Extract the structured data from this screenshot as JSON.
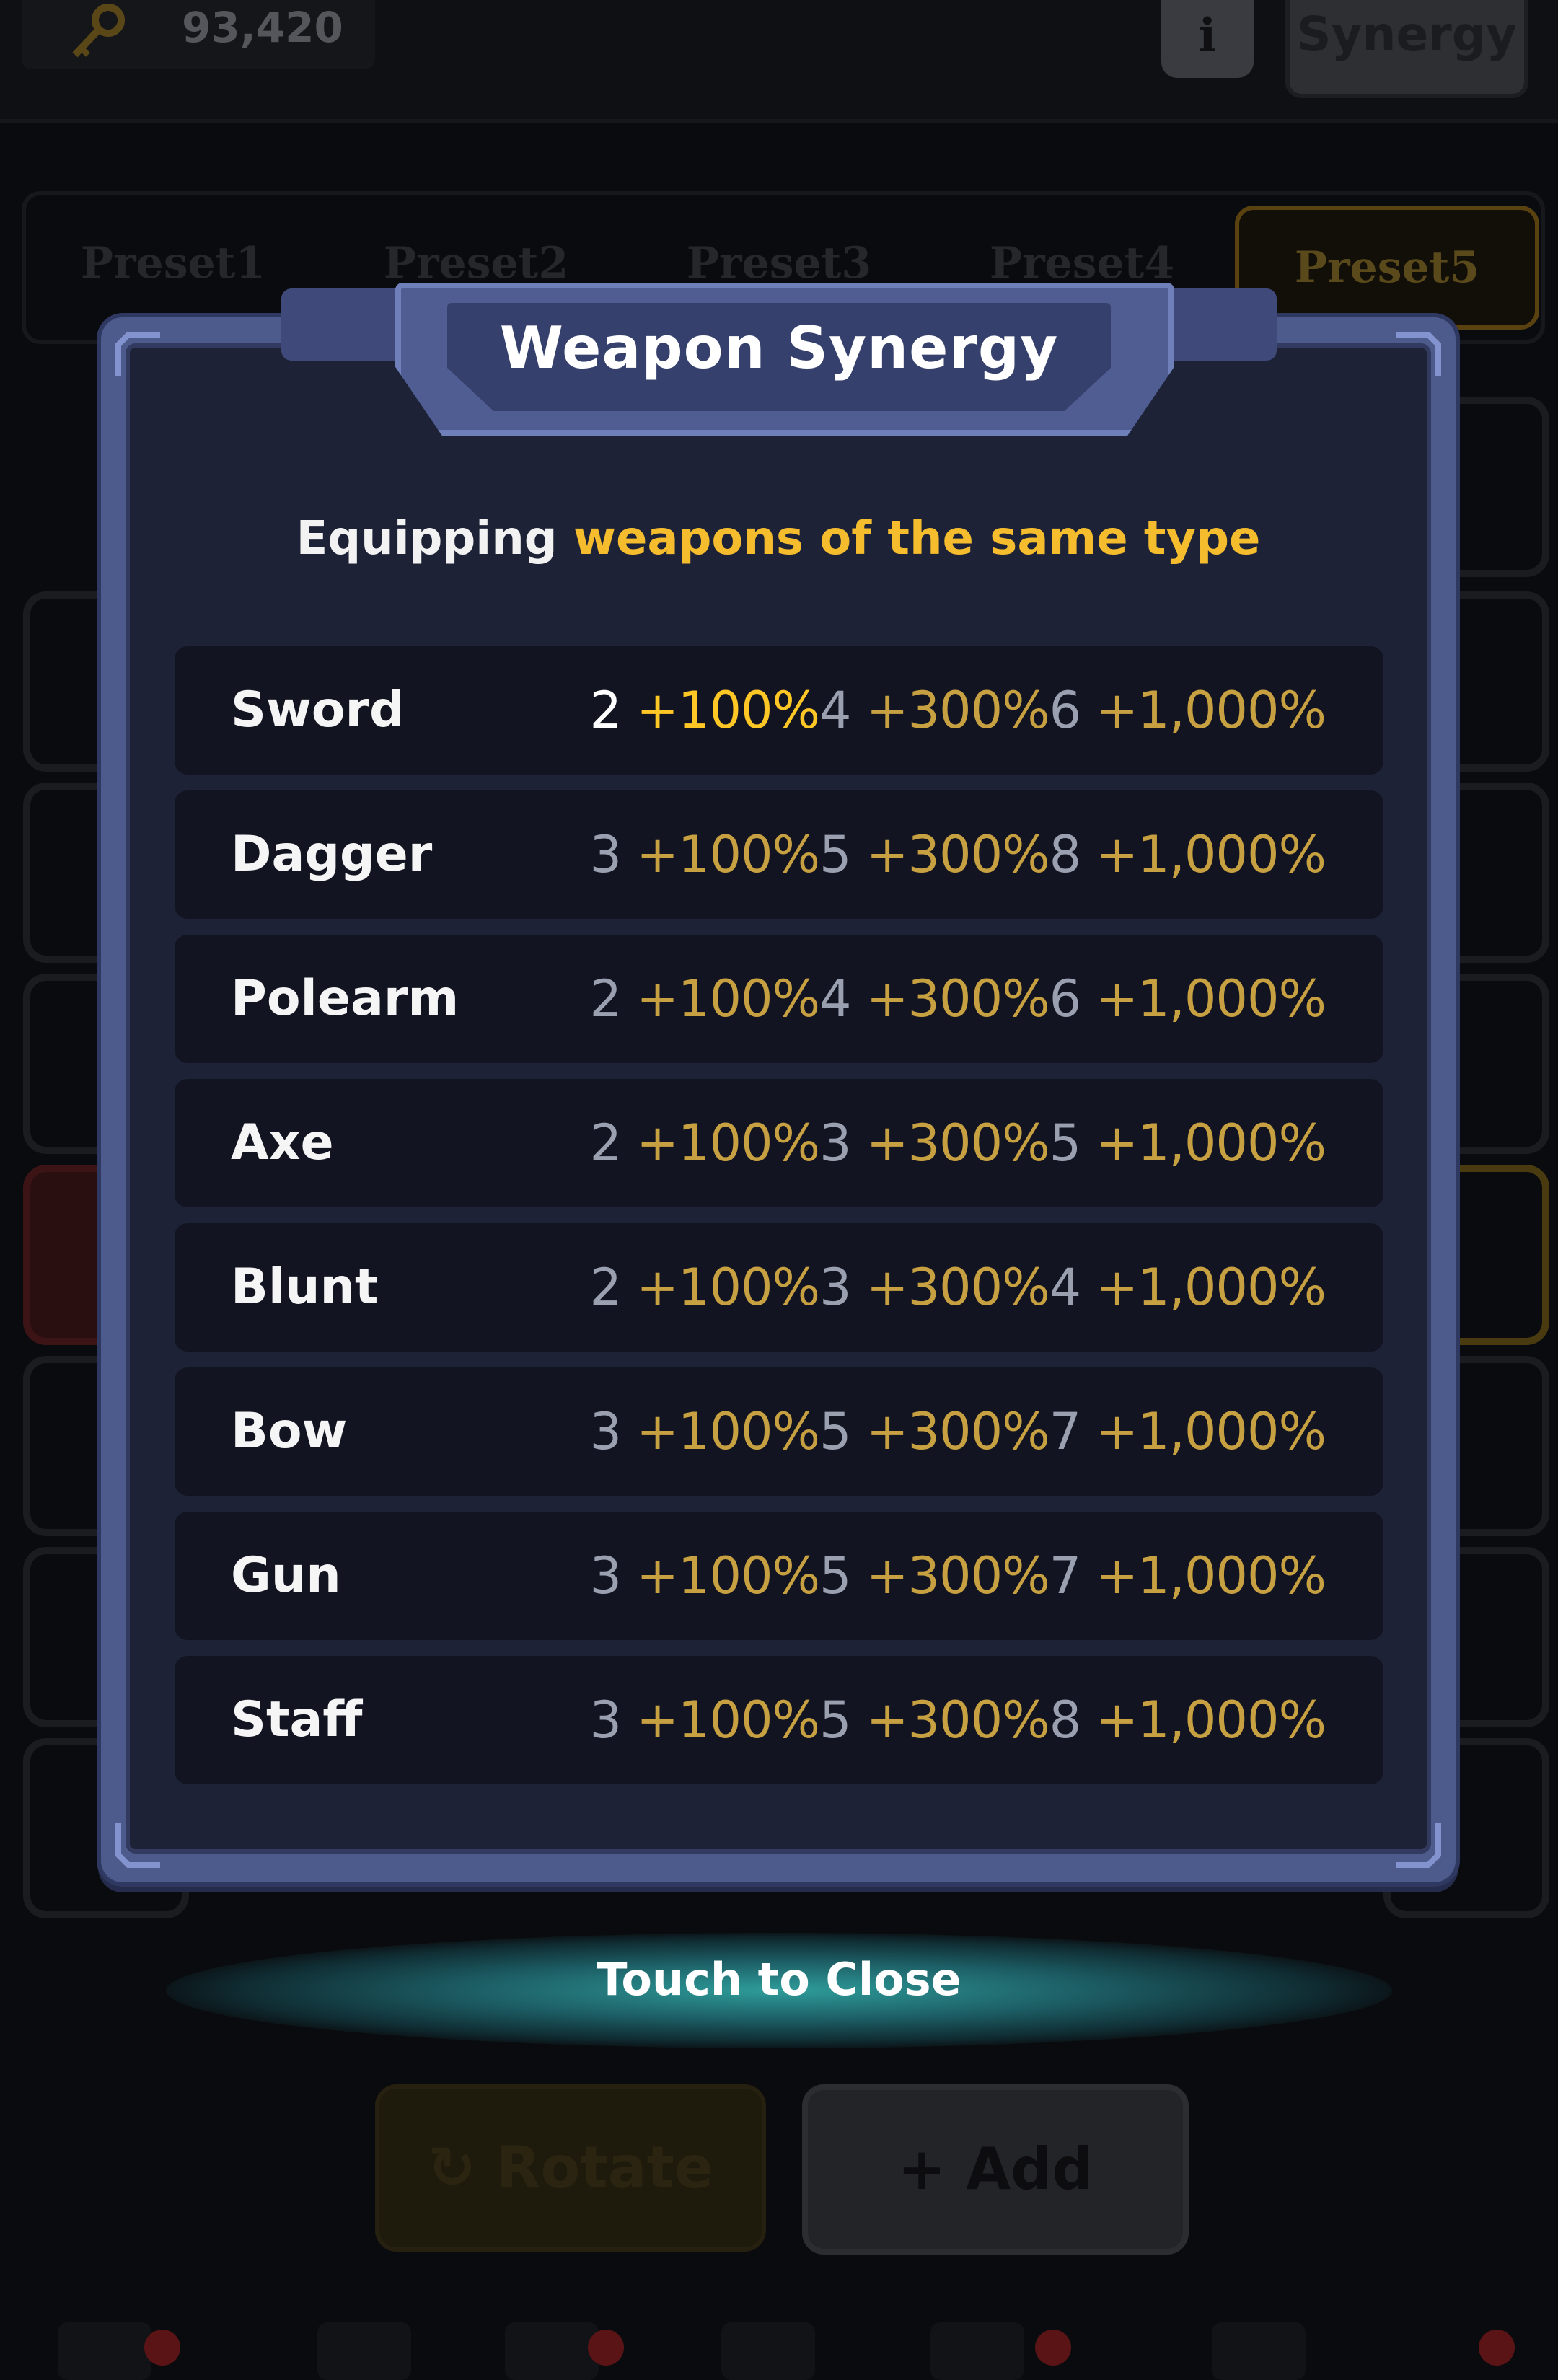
{
  "header": {
    "currency_value": "93,420",
    "info_label": "i",
    "synergy_label": "Synergy"
  },
  "presets": {
    "tabs": [
      "Preset1",
      "Preset2",
      "Preset3",
      "Preset4",
      "Preset5"
    ],
    "active": "Preset5"
  },
  "actions": {
    "rotate_label": "Rotate",
    "add_label": "Add"
  },
  "modal": {
    "title": "Weapon Synergy",
    "subtitle_plain": "Equipping ",
    "subtitle_highlight": "weapons of the same type",
    "rows": [
      {
        "name": "Sword",
        "tiers": [
          [
            "2",
            "+100%"
          ],
          [
            "4",
            "+300%"
          ],
          [
            "6",
            "+1,000%"
          ]
        ],
        "active": true
      },
      {
        "name": "Dagger",
        "tiers": [
          [
            "3",
            "+100%"
          ],
          [
            "5",
            "+300%"
          ],
          [
            "8",
            "+1,000%"
          ]
        ],
        "active": false
      },
      {
        "name": "Polearm",
        "tiers": [
          [
            "2",
            "+100%"
          ],
          [
            "4",
            "+300%"
          ],
          [
            "6",
            "+1,000%"
          ]
        ],
        "active": false
      },
      {
        "name": "Axe",
        "tiers": [
          [
            "2",
            "+100%"
          ],
          [
            "3",
            "+300%"
          ],
          [
            "5",
            "+1,000%"
          ]
        ],
        "active": false
      },
      {
        "name": "Blunt",
        "tiers": [
          [
            "2",
            "+100%"
          ],
          [
            "3",
            "+300%"
          ],
          [
            "4",
            "+1,000%"
          ]
        ],
        "active": false
      },
      {
        "name": "Bow",
        "tiers": [
          [
            "3",
            "+100%"
          ],
          [
            "5",
            "+300%"
          ],
          [
            "7",
            "+1,000%"
          ]
        ],
        "active": false
      },
      {
        "name": "Gun",
        "tiers": [
          [
            "3",
            "+100%"
          ],
          [
            "5",
            "+300%"
          ],
          [
            "7",
            "+1,000%"
          ]
        ],
        "active": false
      },
      {
        "name": "Staff",
        "tiers": [
          [
            "3",
            "+100%"
          ],
          [
            "5",
            "+300%"
          ],
          [
            "8",
            "+1,000%"
          ]
        ],
        "active": false
      }
    ]
  },
  "close_label": "Touch to Close",
  "colors": {
    "highlight": "#f5bd2e",
    "bonus": "#c7a042",
    "count": "#9aa0b0",
    "frame": "#4d5a8c"
  },
  "icons": [
    "key-icon",
    "refresh-icon",
    "plus-icon"
  ]
}
